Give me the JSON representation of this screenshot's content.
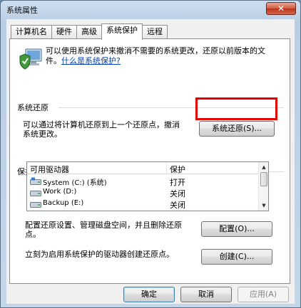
{
  "window": {
    "title": "系统属性",
    "close_symbol": "✕"
  },
  "tabs": [
    {
      "label": "计算机名"
    },
    {
      "label": "硬件"
    },
    {
      "label": "高级"
    },
    {
      "label": "系统保护"
    },
    {
      "label": "远程"
    }
  ],
  "intro": {
    "text": "可以使用系统保护来撤消不需要的系统更改，还原以前版本的文件。",
    "link": "什么是系统保护?"
  },
  "restore": {
    "section_title": "系统还原",
    "description": "可以通过将计算机还原到上一个还原点，撤消系统更改。",
    "button": "系统还原(S)..."
  },
  "protection": {
    "section_title": "保护设置",
    "columns": [
      "可用驱动器",
      "保护"
    ],
    "drives": [
      {
        "name": "System (C:) (系统)",
        "protection": "打开",
        "icon": "system-drive-icon"
      },
      {
        "name": "Work (D:)",
        "protection": "关闭",
        "icon": "drive-icon"
      },
      {
        "name": "Backup (E:)",
        "protection": "关闭",
        "icon": "drive-icon"
      }
    ],
    "configure_text": "配置还原设置、管理磁盘空间，并且删除还原点。",
    "configure_button": "配置(O)...",
    "create_text": "立刻为启用系统保护的驱动器创建还原点。",
    "create_button": "创建(C)..."
  },
  "footer": {
    "ok": "确定",
    "cancel": "取消",
    "apply": "应用(A)"
  },
  "colors": {
    "highlight": "#e00000",
    "link": "#0a43b0"
  }
}
